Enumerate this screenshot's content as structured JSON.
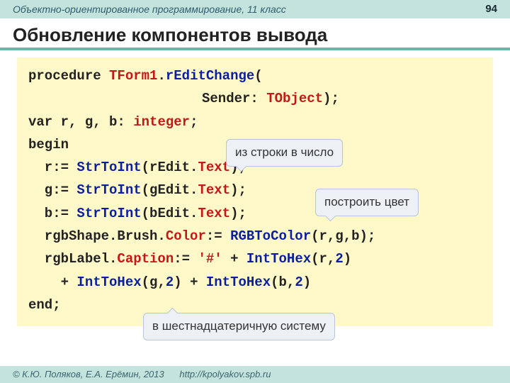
{
  "header": {
    "course": "Объектно-ориентированное программирование, 11 класс",
    "page": "94"
  },
  "title": "Обновление компонентов вывода",
  "code": {
    "l1a": "procedure ",
    "l1b": "TForm1",
    "l1c": ".",
    "l1d": "rEditChange",
    "l1e": "(",
    "l2a": "Sender: ",
    "l2b": "TObject",
    "l2c": ");",
    "l3a": "var r, g, b: ",
    "l3b": "integer",
    "l3c": ";",
    "l4": "begin",
    "l5a": "  r:= ",
    "l5b": "StrToInt",
    "l5c": "(rEdit.",
    "l5d": "Text",
    "l5e": ");",
    "l6a": "  g:= ",
    "l6b": "StrToInt",
    "l6c": "(gEdit.",
    "l6d": "Text",
    "l6e": ");",
    "l7a": "  b:= ",
    "l7b": "StrToInt",
    "l7c": "(bEdit.",
    "l7d": "Text",
    "l7e": ");",
    "l8a": "  rgbShape.Brush.",
    "l8b": "Color",
    "l8c": ":= ",
    "l8d": "RGBToColor",
    "l8e": "(r,g,b);",
    "l9a": "  rgbLabel.",
    "l9b": "Caption",
    "l9c": ":= ",
    "l9d": "'#'",
    "l9e": " + ",
    "l9f": "IntToHex",
    "l9g": "(r,",
    "l9h": "2",
    "l9i": ")",
    "l10a": "    + ",
    "l10b": "IntToHex",
    "l10c": "(g,",
    "l10d": "2",
    "l10e": ") + ",
    "l10f": "IntToHex",
    "l10g": "(b,",
    "l10h": "2",
    "l10i": ")",
    "l11": "end;"
  },
  "callouts": {
    "c1": "из строки в число",
    "c2": "построить цвет",
    "c3": "в шестнадцатеричную систему"
  },
  "footer": {
    "copy": "© К.Ю. Поляков, Е.А. Ерёмин, 2013",
    "url": "http://kpolyakov.spb.ru"
  }
}
